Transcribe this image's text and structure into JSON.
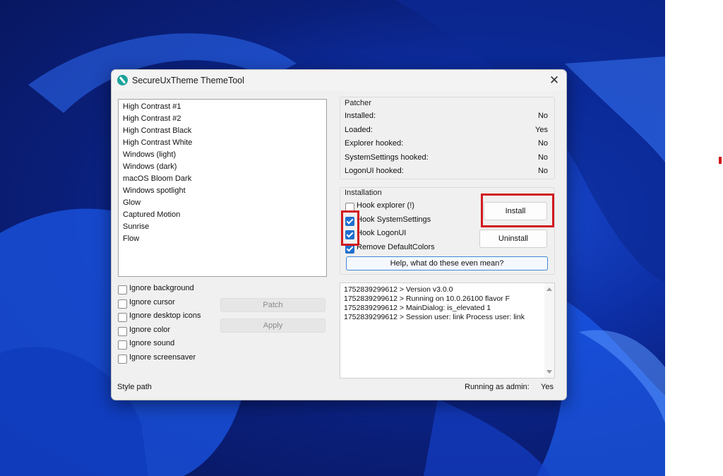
{
  "window": {
    "title": "SecureUxTheme ThemeTool",
    "close_glyph": "✕"
  },
  "themes": [
    "High Contrast #1",
    "High Contrast #2",
    "High Contrast Black",
    "High Contrast White",
    "Windows (light)",
    "Windows (dark)",
    "macOS Bloom Dark",
    "Windows spotlight",
    "Glow",
    "Captured Motion",
    "Sunrise",
    "Flow"
  ],
  "options": {
    "ignore_background": "Ignore background",
    "ignore_cursor": "Ignore cursor",
    "ignore_desktop_icons": "Ignore desktop icons",
    "ignore_color": "Ignore color",
    "ignore_sound": "Ignore sound",
    "ignore_screensaver": "Ignore screensaver"
  },
  "buttons": {
    "patch": "Patch",
    "apply": "Apply",
    "install": "Install",
    "uninstall": "Uninstall",
    "help": "Help, what do these even mean?"
  },
  "patcher": {
    "label": "Patcher",
    "rows": [
      {
        "key": "Installed:",
        "value": "No"
      },
      {
        "key": "Loaded:",
        "value": "Yes"
      },
      {
        "key": "Explorer hooked:",
        "value": "No"
      },
      {
        "key": "SystemSettings hooked:",
        "value": "No"
      },
      {
        "key": "LogonUI hooked:",
        "value": "No"
      }
    ]
  },
  "installation": {
    "label": "Installation",
    "hook_explorer": {
      "label": "Hook explorer (!)",
      "checked": false
    },
    "hook_systemsettings": {
      "label": "Hook SystemSettings",
      "checked": true
    },
    "hook_logonui": {
      "label": "Hook LogonUI",
      "checked": true
    },
    "remove_defaultcolors": {
      "label": "Remove DefaultColors",
      "checked": true
    }
  },
  "log": [
    "1752839299612 > Version v3.0.0",
    "1752839299612 > Running on 10.0.26100 flavor F",
    "1752839299612 > MainDialog: is_elevated 1",
    "1752839299612 > Session user: link Process user: link"
  ],
  "footer": {
    "style_path": "Style path",
    "admin_label": "Running as admin:",
    "admin_value": "Yes"
  },
  "colors": {
    "highlight": "#d11a1f",
    "checkbox_accent": "#1f6fcf",
    "wallpaper": "#0d2fa6"
  }
}
